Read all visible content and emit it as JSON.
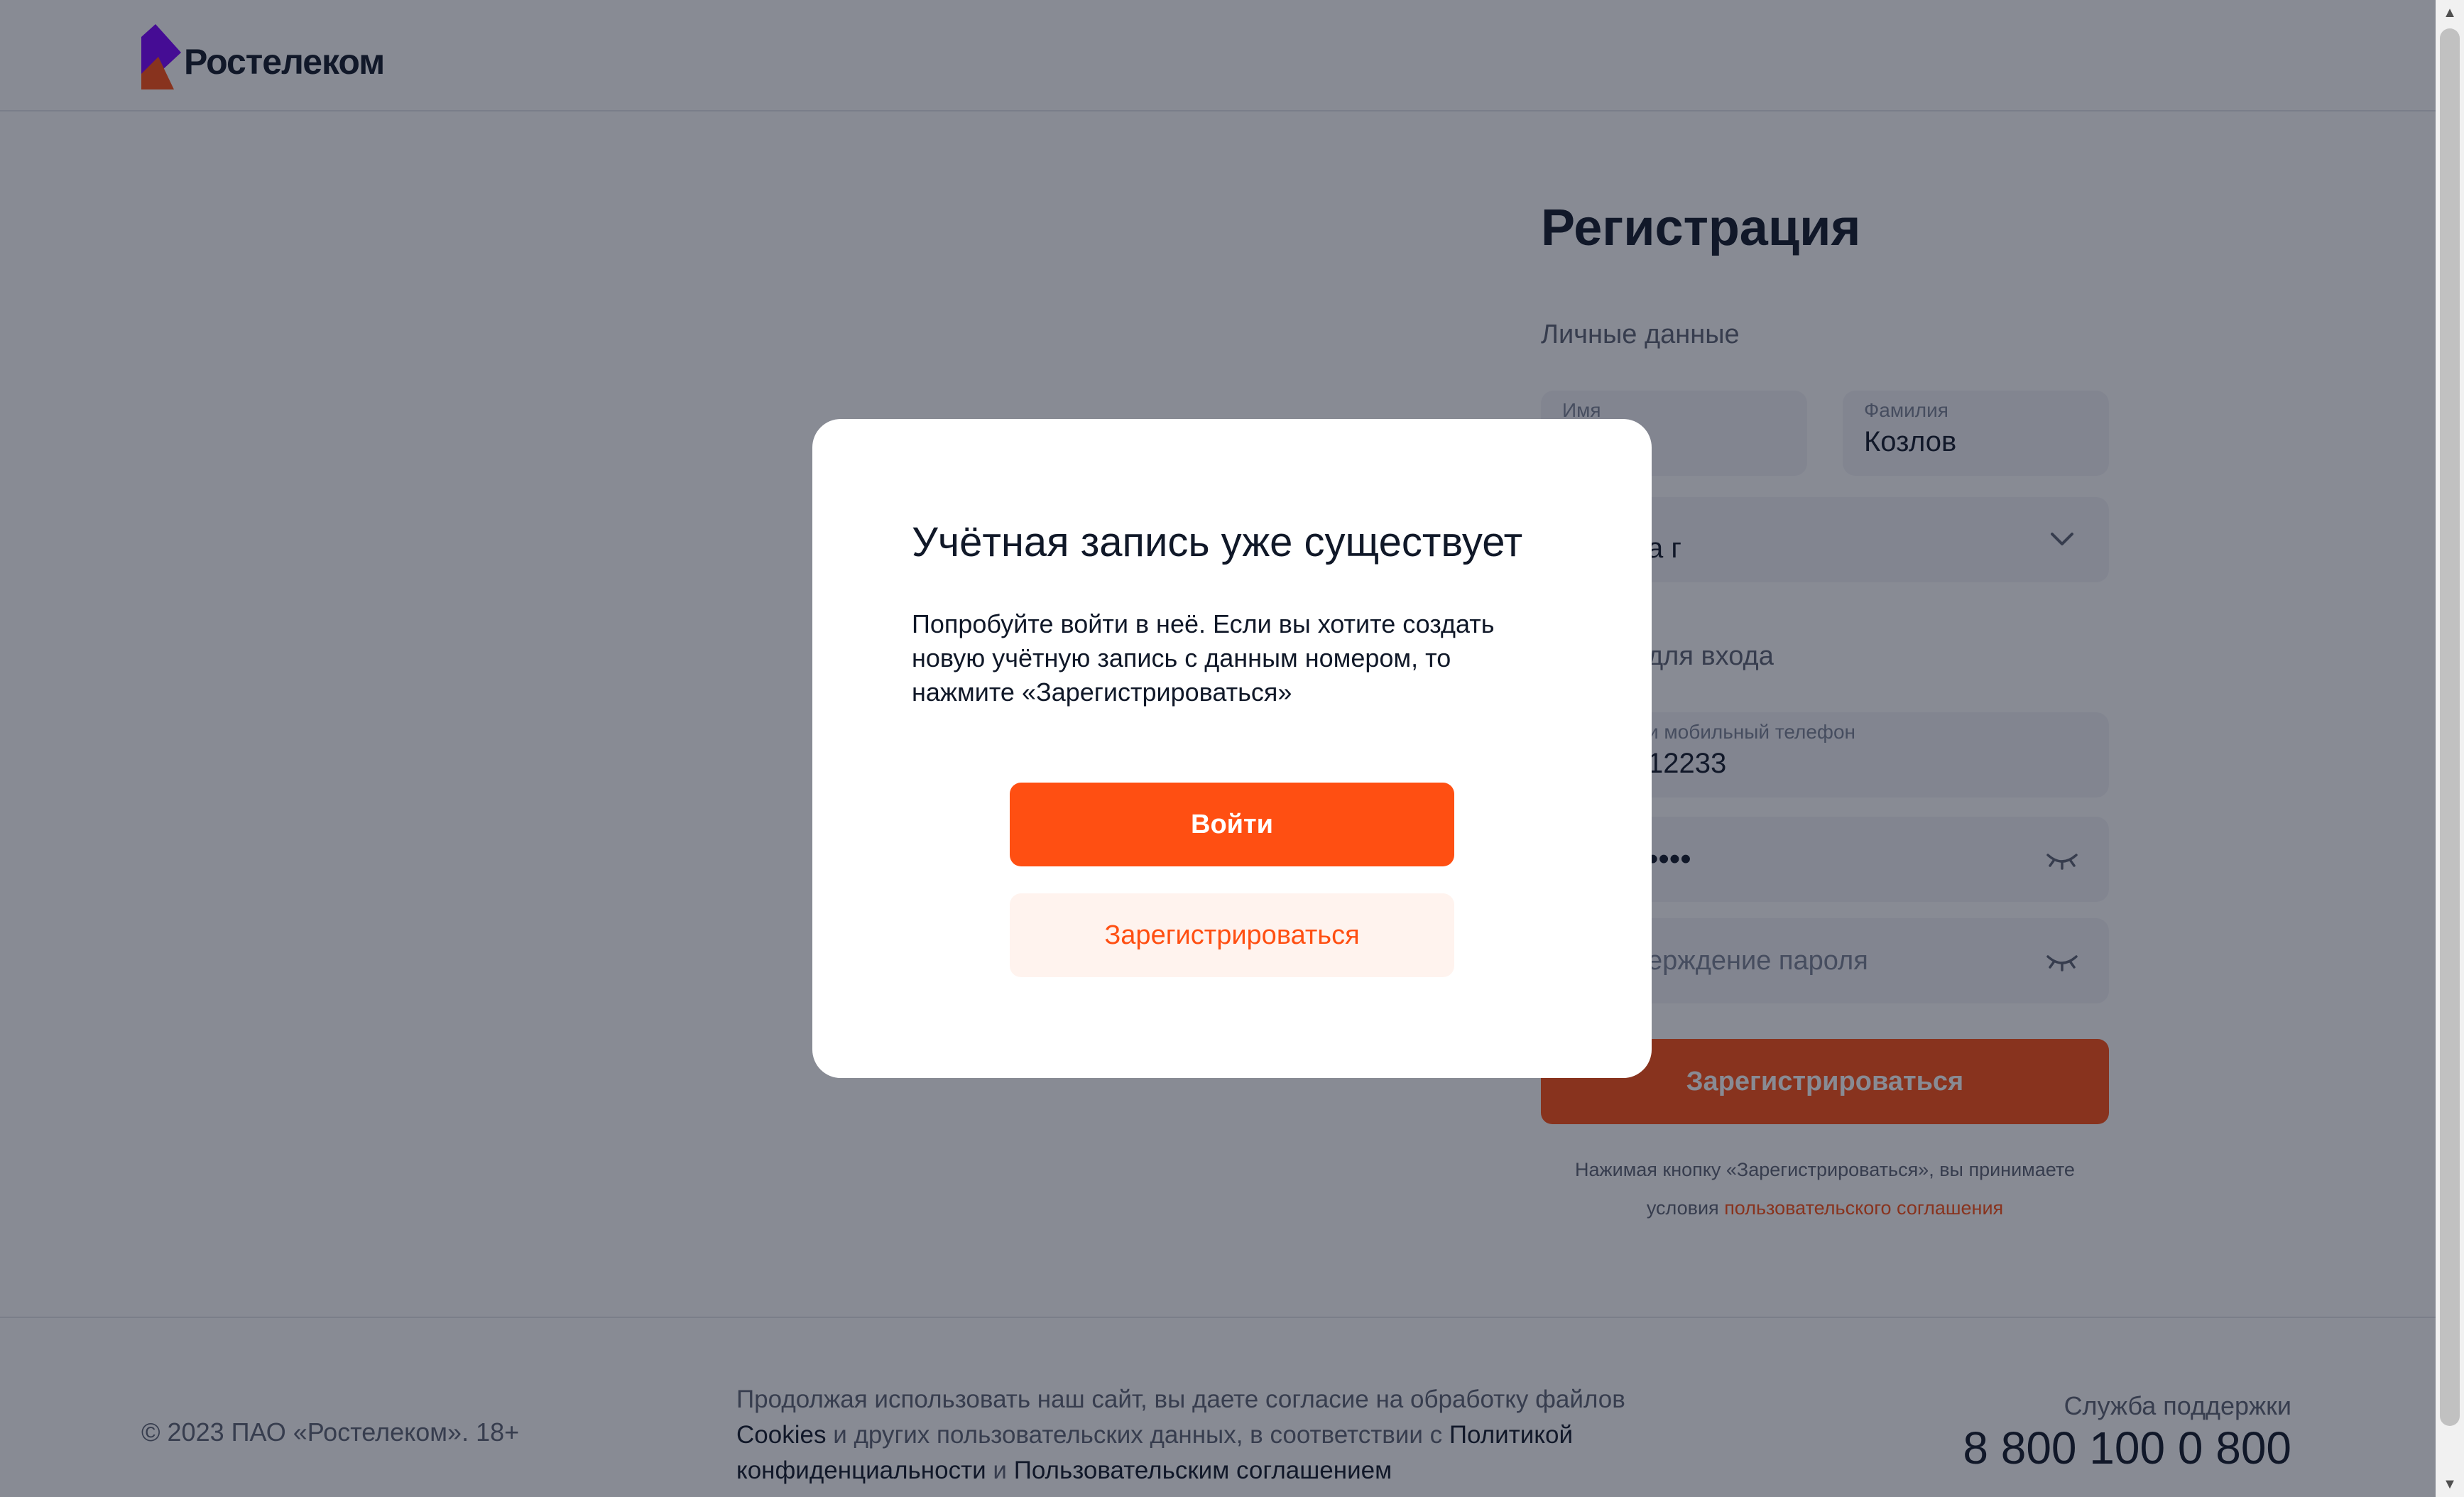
{
  "header": {
    "logo_text": "Ростелеком",
    "colors": {
      "purple": "#7800ff",
      "orange": "#ff4f12"
    }
  },
  "registration": {
    "title": "Регистрация",
    "personal_section": "Личные данные",
    "first_name": {
      "label": "Имя",
      "value": ""
    },
    "last_name": {
      "label": "Фамилия",
      "value": "Козлов"
    },
    "region": {
      "value": "а г"
    },
    "login_section": "для входа",
    "phone": {
      "label": "и мобильный телефон",
      "value": "12233"
    },
    "password": {
      "value": "••••"
    },
    "password_confirm": {
      "placeholder": "ерждение пароля"
    },
    "submit_label": "Зарегистрироваться",
    "terms_text": "Нажимая кнопку «Зарегистрироваться», вы принимаете условия",
    "terms_link": "пользовательского соглашения"
  },
  "modal": {
    "title": "Учётная запись уже существует",
    "text": "Попробуйте войти в неё. Если вы хотите создать новую учётную запись с данным номером, то нажмите «Зарегистрироваться»",
    "login_label": "Войти",
    "register_label": "Зарегистрироваться"
  },
  "footer": {
    "copyright": "© 2023 ПАО «Ростелеком». 18+",
    "cookie_prefix": "Продолжая использовать наш сайт, вы даете согласие на обработку файлов",
    "cookie_link1": "Cookies",
    "cookie_mid1": "и других пользовательских данных, в соответствии с",
    "cookie_link2": "Политикой конфиденциальности",
    "cookie_mid2": "и",
    "cookie_link3": "Пользовательским соглашением",
    "support_label": "Служба поддержки",
    "support_phone": "8 800 100 0 800"
  }
}
